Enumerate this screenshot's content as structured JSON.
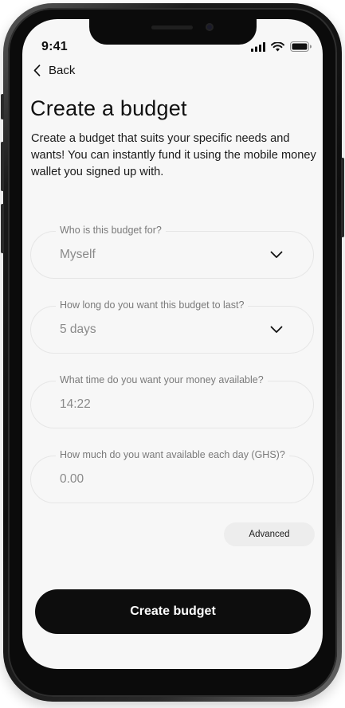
{
  "status_bar": {
    "time": "9:41"
  },
  "nav": {
    "back_label": "Back"
  },
  "header": {
    "title": "Create a budget",
    "description": "Create a budget that suits your specific needs and wants! You can instantly fund it using the mobile money wallet you signed up with."
  },
  "form": {
    "fields": [
      {
        "label": "Who is this budget for?",
        "value": "Myself",
        "type": "select"
      },
      {
        "label": "How long do you want this budget to last?",
        "value": "5 days",
        "type": "select"
      },
      {
        "label": "What time do you want your money available?",
        "value": "14:22",
        "type": "time"
      },
      {
        "label": "How much do you want available each day (GHS)?",
        "value": "0.00",
        "type": "amount"
      }
    ],
    "advanced_label": "Advanced",
    "submit_label": "Create budget"
  },
  "colors": {
    "primary_button": "#0d0d0d",
    "screen_background": "#f7f7f7",
    "label_text": "#7a7a7a"
  },
  "icons": [
    "back-chevron-icon",
    "cellular-signal-icon",
    "wifi-icon",
    "battery-icon",
    "chevron-down-icon"
  ]
}
